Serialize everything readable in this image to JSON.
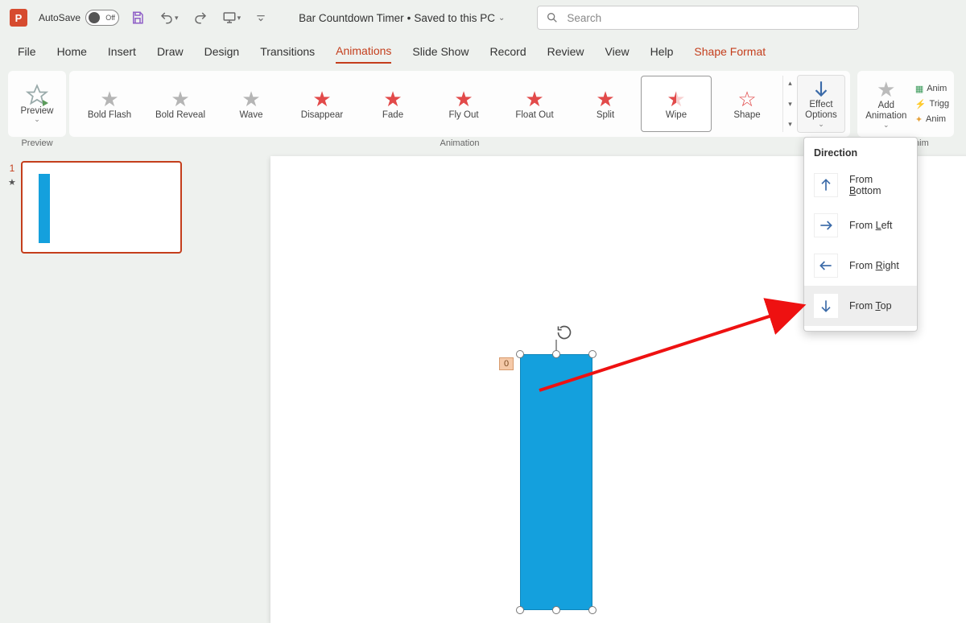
{
  "title": {
    "autosave_label": "AutoSave",
    "autosave_state": "Off",
    "doc_name": "Bar Countdown Timer",
    "doc_status": "Saved to this PC",
    "search_placeholder": "Search"
  },
  "tabs": {
    "items": [
      "File",
      "Home",
      "Insert",
      "Draw",
      "Design",
      "Transitions",
      "Animations",
      "Slide Show",
      "Record",
      "Review",
      "View",
      "Help",
      "Shape Format"
    ],
    "active": "Animations",
    "context": "Shape Format"
  },
  "ribbon": {
    "preview_group": "Preview",
    "preview_btn": "Preview",
    "animation_group": "Animation",
    "gallery": [
      {
        "label": "Bold Flash",
        "icon": "grey",
        "sel": false
      },
      {
        "label": "Bold Reveal",
        "icon": "grey",
        "sel": false
      },
      {
        "label": "Wave",
        "icon": "grey",
        "sel": false
      },
      {
        "label": "Disappear",
        "icon": "red-fill",
        "sel": false
      },
      {
        "label": "Fade",
        "icon": "red-fill",
        "sel": false
      },
      {
        "label": "Fly Out",
        "icon": "red-fill",
        "sel": false
      },
      {
        "label": "Float Out",
        "icon": "red-fill",
        "sel": false
      },
      {
        "label": "Split",
        "icon": "red-fill",
        "sel": false
      },
      {
        "label": "Wipe",
        "icon": "red-outline",
        "sel": true
      },
      {
        "label": "Shape",
        "icon": "shape",
        "sel": false
      }
    ],
    "effect_options": "Effect Options",
    "add_animation": "Add Animation",
    "adv_group": "anced Anim",
    "adv_items": [
      "Anim",
      "Trigg",
      "Anim"
    ]
  },
  "slide": {
    "number": "1",
    "anim_order": "0"
  },
  "dropdown": {
    "header": "Direction",
    "items": [
      {
        "label": "From ",
        "accel": "B",
        "rest": "ottom",
        "dir": "up"
      },
      {
        "label": "From ",
        "accel": "L",
        "rest": "eft",
        "dir": "right"
      },
      {
        "label": "From ",
        "accel": "R",
        "rest": "ight",
        "dir": "left"
      },
      {
        "label": "From ",
        "accel": "T",
        "rest": "op",
        "dir": "down"
      }
    ],
    "hover_index": 3
  },
  "colors": {
    "accent": "#c43e1c",
    "shape": "#14a0dd"
  }
}
